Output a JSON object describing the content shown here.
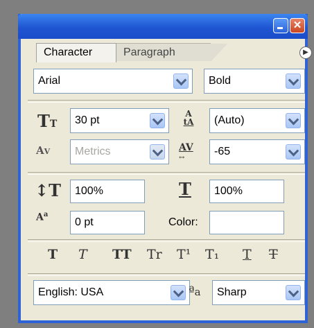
{
  "tabs": {
    "active": "Character",
    "inactive": "Paragraph"
  },
  "font": {
    "family": "Arial",
    "style": "Bold"
  },
  "size": {
    "value": "30 pt"
  },
  "leading": {
    "value": "(Auto)"
  },
  "kerning": {
    "value": "Metrics"
  },
  "tracking": {
    "value": "-65"
  },
  "scale": {
    "vertical": "100%",
    "horizontal": "100%"
  },
  "baseline": {
    "value": "0 pt"
  },
  "color": {
    "label": "Color:"
  },
  "language": {
    "value": "English: USA"
  },
  "antialias": {
    "value": "Sharp"
  },
  "style_buttons": {
    "bold": "T",
    "italic": "T",
    "allcaps": "TT",
    "smallcaps": "Tr",
    "superscript": "T¹",
    "subscript": "T₁",
    "underline": "T",
    "strike": "T"
  },
  "colors": {
    "title_bar": "#1f55d2",
    "panel_bg": "#ece9d8",
    "close_button": "#c94621"
  }
}
